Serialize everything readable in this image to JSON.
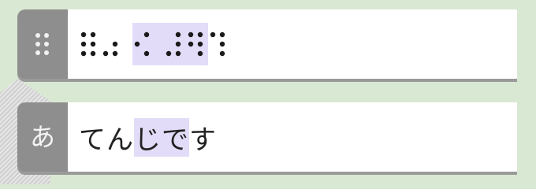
{
  "braille_panel": {
    "icon": "braille-dots-icon",
    "cells": [
      {
        "dots": [
          1,
          2,
          3,
          4,
          5,
          6
        ],
        "highlight": false
      },
      {
        "dots": [
          3,
          5,
          6
        ],
        "highlight": false
      },
      {
        "dots": [],
        "highlight": false,
        "space": true
      },
      {
        "dots": [
          2,
          4,
          6
        ],
        "highlight": true
      },
      {
        "dots": [],
        "highlight": true,
        "space": true
      },
      {
        "dots": [
          3,
          4,
          5,
          6
        ],
        "highlight": true
      },
      {
        "dots": [
          1,
          2,
          4,
          5,
          6
        ],
        "highlight": true
      },
      {
        "dots": [
          1,
          4,
          5,
          6
        ],
        "highlight": false
      }
    ]
  },
  "kana_panel": {
    "tab_label": "あ",
    "text_before": "てん",
    "text_highlight": "じで",
    "text_after": "す"
  },
  "colors": {
    "background": "#d9e8d2",
    "tab": "#8e8e8e",
    "highlight": "#e3dcf8"
  }
}
